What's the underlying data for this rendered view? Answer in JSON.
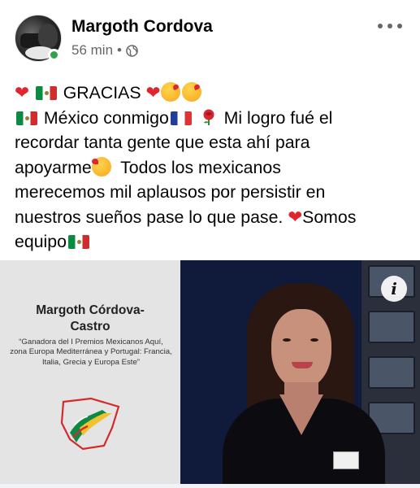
{
  "post": {
    "author": "Margoth Cordova",
    "timestamp": "56 min",
    "separator": "•",
    "privacy_icon": "globe-icon",
    "more_icon": "more-options-icon"
  },
  "text": {
    "line1_word": "GRACIAS",
    "line2_a": "México conmigo",
    "line2_b": "Mi logro fué el",
    "line3": "recordar tanta gente que esta ahí para",
    "line4_a": "apoyarme",
    "line4_b": "Todos los mexicanos",
    "line5": "merecemos mil aplausos por persistir en",
    "line6_a": "nuestros sueños pase lo que pase.",
    "line6_b": "Somos",
    "line7": "equipo"
  },
  "image": {
    "card_name_line1": "Margoth Córdova-",
    "card_name_line2": "Castro",
    "card_quote": "“Ganadora del I Premios Mexicanos Aquí, zona Europa Mediterránea y Portugal: Francia, Italia, Grecia y Europa Este”",
    "info_label": "i"
  },
  "colors": {
    "heart": "#e1252f",
    "online": "#31a24c",
    "meta_text": "#65676b"
  }
}
